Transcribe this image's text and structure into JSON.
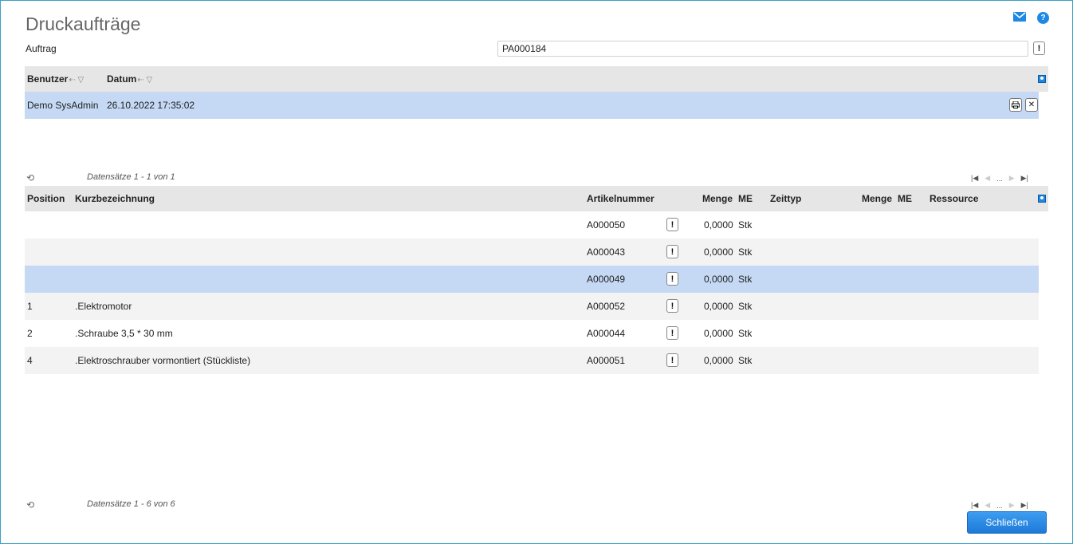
{
  "page": {
    "title": "Druckaufträge",
    "order_label": "Auftrag",
    "order_value": "PA000184"
  },
  "jobs_grid": {
    "columns": {
      "user": "Benutzer",
      "date": "Datum"
    },
    "rows": [
      {
        "user": "Demo SysAdmin",
        "date": "26.10.2022 17:35:02"
      }
    ],
    "pager_info": "Datensätze 1 - 1 von 1"
  },
  "items_grid": {
    "columns": {
      "position": "Position",
      "description": "Kurzbezeichnung",
      "article": "Artikelnummer",
      "qty": "Menge",
      "unit": "ME",
      "time_type": "Zeittyp",
      "qty2": "Menge",
      "unit2": "ME",
      "resource": "Ressource"
    },
    "rows": [
      {
        "position": "",
        "description": "",
        "article": "A000050",
        "qty": "0,0000",
        "unit": "Stk"
      },
      {
        "position": "",
        "description": "",
        "article": "A000043",
        "qty": "0,0000",
        "unit": "Stk"
      },
      {
        "position": "",
        "description": "",
        "article": "A000049",
        "qty": "0,0000",
        "unit": "Stk"
      },
      {
        "position": "1",
        "description": ".Elektromotor",
        "article": "A000052",
        "qty": "0,0000",
        "unit": "Stk"
      },
      {
        "position": "2",
        "description": ".Schraube 3,5 * 30 mm",
        "article": "A000044",
        "qty": "0,0000",
        "unit": "Stk"
      },
      {
        "position": "4",
        "description": ".Elektroschrauber vormontiert (Stückliste)",
        "article": "A000051",
        "qty": "0,0000",
        "unit": "Stk"
      }
    ],
    "pager_info": "Datensätze 1 - 6 von 6"
  },
  "pager": {
    "ellipsis": "..."
  },
  "buttons": {
    "close": "Schließen",
    "lookup": "!"
  },
  "colors": {
    "accent": "#1e88e5",
    "selected_row": "#c5d9f5",
    "header_bg": "#e6e6e6"
  }
}
